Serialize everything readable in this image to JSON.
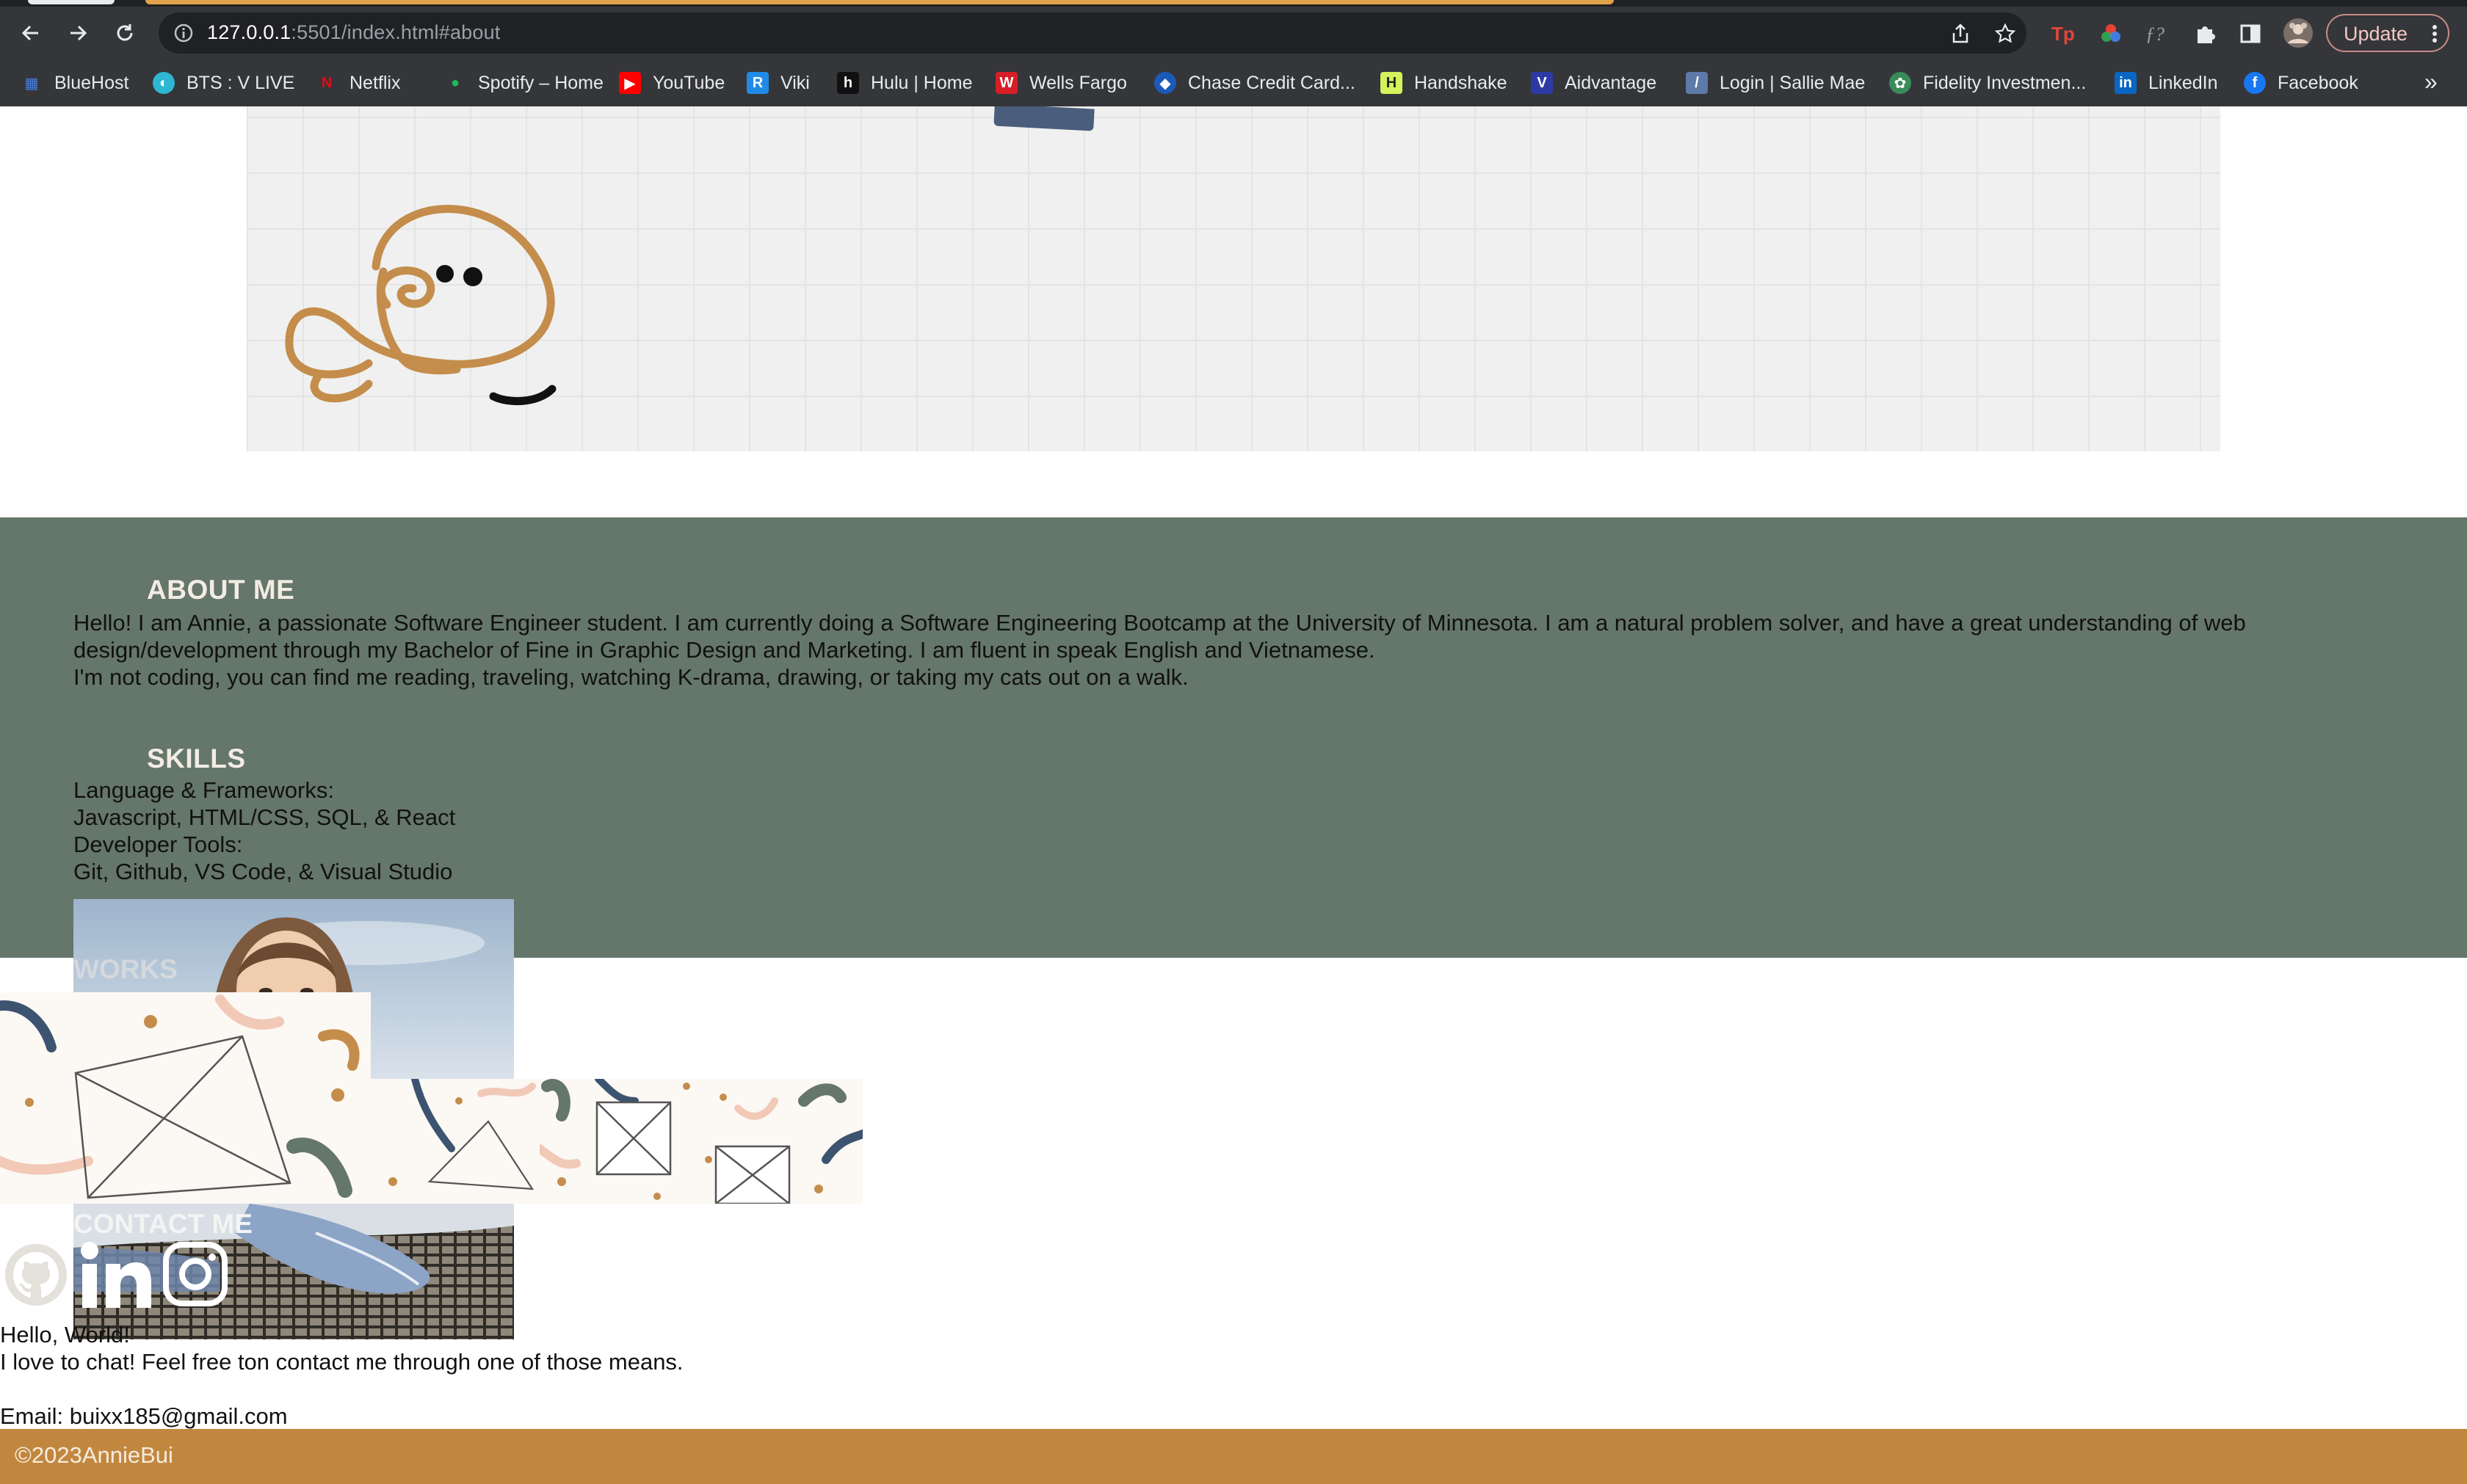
{
  "browser": {
    "url_host": "127.0.0.1",
    "url_rest": ":5501/index.html#about",
    "update_label": "Update",
    "bookmarks": [
      {
        "label": "BlueHost",
        "icon": "grid-icon",
        "color": "#4a7fe0"
      },
      {
        "label": "BTS : V LIVE",
        "icon": "vlive-icon",
        "color": "#2db7d3"
      },
      {
        "label": "Netflix",
        "icon": "netflix-icon",
        "color": "#e50914"
      },
      {
        "label": "Spotify – Home",
        "icon": "spotify-icon",
        "color": "#1db954"
      },
      {
        "label": "YouTube",
        "icon": "youtube-icon",
        "color": "#ff0000"
      },
      {
        "label": "Viki",
        "icon": "viki-icon",
        "color": "#1f8be6"
      },
      {
        "label": "Hulu | Home",
        "icon": "hulu-icon",
        "color": "#111111"
      },
      {
        "label": "Wells Fargo",
        "icon": "wellsfargo-icon",
        "color": "#d71e28"
      },
      {
        "label": "Chase Credit Card...",
        "icon": "chase-icon",
        "color": "#1a5bb8"
      },
      {
        "label": "Handshake",
        "icon": "handshake-icon",
        "color": "#d5f25d"
      },
      {
        "label": "Aidvantage",
        "icon": "aidvantage-icon",
        "color": "#2d3aa6"
      },
      {
        "label": "Login | Sallie Mae",
        "icon": "salliemae-icon",
        "color": "#5d7aa8"
      },
      {
        "label": "Fidelity Investmen...",
        "icon": "fidelity-icon",
        "color": "#3a8b5a"
      },
      {
        "label": "LinkedIn",
        "icon": "linkedin-icon",
        "color": "#0a66c2"
      },
      {
        "label": "Facebook",
        "icon": "facebook-icon",
        "color": "#1877f2"
      }
    ],
    "more_label": "»"
  },
  "about": {
    "title": "ABOUT ME",
    "paragraph_line1": "Hello! I am Annie, a passionate Software Engineer student. I am currently doing a Software Engineering Bootcamp at the University of Minnesota. I am a natural problem solver, and have a great understanding of web",
    "paragraph_line2": "design/development through my Bachelor of Fine in Graphic Design and Marketing. I am fluent in speak English and Vietnamese.",
    "paragraph_line3": "I'm not coding, you can find me reading, traveling, watching K-drama, drawing, or taking my cats out on a walk."
  },
  "skills": {
    "title": "SKILLS",
    "lines": [
      "Language & Frameworks:",
      "Javascript, HTML/CSS, SQL, & React",
      "Developer Tools:",
      "Git, Github, VS Code, & Visual Studio"
    ]
  },
  "works": {
    "title": "WORKS"
  },
  "contact": {
    "title": "CONTACT ME",
    "hello": "Hello, World!",
    "invite": "I love to chat! Feel free ton contact me through one of those means.",
    "email": "Email: buixx185@gmail.com"
  },
  "footer": {
    "copyright": "©2023AnnieBui"
  },
  "colors": {
    "about_bg": "#65766a",
    "footer_bg": "#c2873f",
    "doodle": "#c48d4b"
  }
}
